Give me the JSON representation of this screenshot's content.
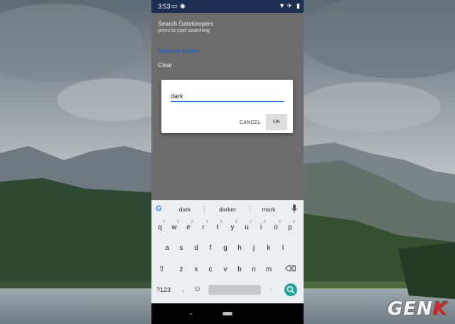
{
  "watermark": {
    "prefix": "GEN",
    "suffix": "K"
  },
  "status_bar": {
    "time": "3:53",
    "left_icons": [
      "screenshot-icon",
      "location-icon"
    ],
    "right_icons": [
      "wifi-icon",
      "airplane-icon",
      "battery-icon"
    ]
  },
  "app": {
    "title": "Search Gatekeepers",
    "subtitle": "press to start searching",
    "recent_label": "Recently Edited:",
    "clear_label": "Clear"
  },
  "dialog": {
    "input_value": "dark",
    "cancel_label": "CANCEL",
    "ok_label": "OK"
  },
  "keyboard": {
    "suggestions": [
      "dark",
      "darker",
      "mark"
    ],
    "row1": [
      "q",
      "w",
      "e",
      "r",
      "t",
      "y",
      "u",
      "i",
      "o",
      "p"
    ],
    "row1_hints": [
      "1",
      "2",
      "3",
      "4",
      "5",
      "6",
      "7",
      "8",
      "9",
      "0"
    ],
    "row2": [
      "a",
      "s",
      "d",
      "f",
      "g",
      "h",
      "j",
      "k",
      "l"
    ],
    "row3": [
      "z",
      "x",
      "c",
      "v",
      "b",
      "n",
      "m"
    ],
    "symbols_label": "?123",
    "comma": ",",
    "period": "."
  },
  "colors": {
    "status_bar": "#1c2f52",
    "accent": "#1a73e8",
    "enter_key": "#26a69a"
  }
}
